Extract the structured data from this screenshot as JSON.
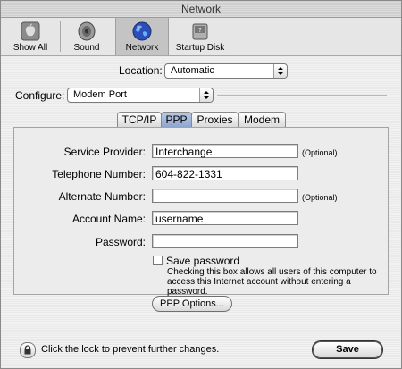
{
  "window": {
    "title": "Network"
  },
  "toolbar": {
    "items": [
      {
        "label": "Show All",
        "icon": "apple-icon"
      },
      {
        "label": "Sound",
        "icon": "speaker-icon"
      },
      {
        "label": "Network",
        "icon": "globe-icon",
        "selected": true
      },
      {
        "label": "Startup Disk",
        "icon": "disk-icon"
      }
    ]
  },
  "location": {
    "label": "Location:",
    "value": "Automatic"
  },
  "configure": {
    "label": "Configure:",
    "value": "Modem Port"
  },
  "tabs": [
    {
      "label": "TCP/IP"
    },
    {
      "label": "PPP",
      "selected": true
    },
    {
      "label": "Proxies"
    },
    {
      "label": "Modem"
    }
  ],
  "form": {
    "service_provider": {
      "label": "Service Provider:",
      "value": "Interchange",
      "note": "(Optional)"
    },
    "telephone_number": {
      "label": "Telephone Number:",
      "value": "604-822-1331"
    },
    "alternate_number": {
      "label": "Alternate Number:",
      "value": "",
      "note": "(Optional)"
    },
    "account_name": {
      "label": "Account Name:",
      "value": "username"
    },
    "password": {
      "label": "Password:",
      "value": ""
    },
    "save_password": {
      "label": "Save password",
      "checked": false
    },
    "save_password_note": "Checking this box allows all users of this computer to access this Internet account without entering a password.",
    "ppp_options_label": "PPP Options..."
  },
  "footer": {
    "lock_text": "Click the lock to prevent further changes.",
    "save_label": "Save"
  },
  "colors": {
    "selected_tab": "#8ea6cf",
    "toolbar_selected": "#c4c4c4"
  }
}
